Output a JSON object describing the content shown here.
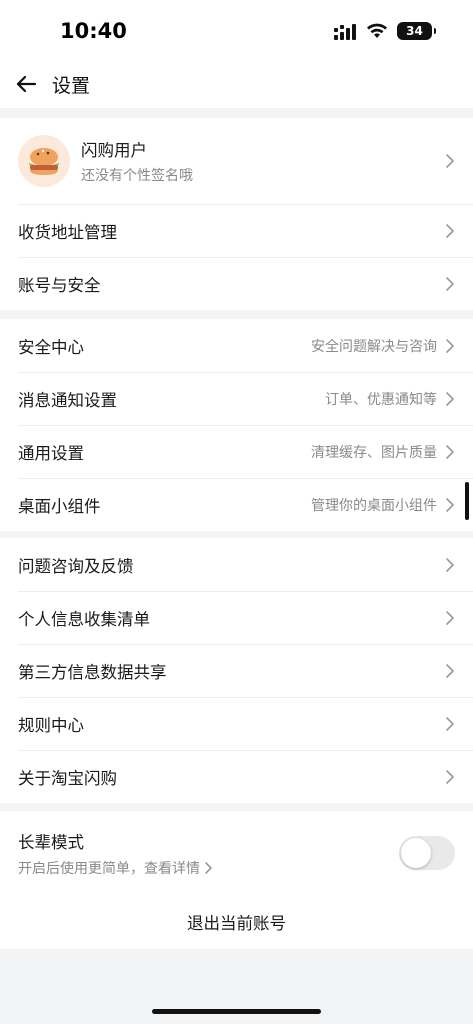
{
  "status_bar": {
    "time": "10:40",
    "battery": "34"
  },
  "nav": {
    "title": "设置"
  },
  "profile": {
    "name": "闪购用户",
    "signature": "还没有个性签名哦"
  },
  "account_section": [
    {
      "label": "收货地址管理"
    },
    {
      "label": "账号与安全"
    }
  ],
  "settings_section": [
    {
      "label": "安全中心",
      "value": "安全问题解决与咨询"
    },
    {
      "label": "消息通知设置",
      "value": "订单、优惠通知等"
    },
    {
      "label": "通用设置",
      "value": "清理缓存、图片质量"
    },
    {
      "label": "桌面小组件",
      "value": "管理你的桌面小组件"
    }
  ],
  "info_section": [
    {
      "label": "问题咨询及反馈"
    },
    {
      "label": "个人信息收集清单"
    },
    {
      "label": "第三方信息数据共享"
    },
    {
      "label": "规则中心"
    },
    {
      "label": "关于淘宝闪购"
    }
  ],
  "elder_mode": {
    "title": "长辈模式",
    "subtitle": "开启后使用更简单，查看详情",
    "enabled": false
  },
  "logout": {
    "label": "退出当前账号"
  },
  "icons": {
    "back": "arrow-left-icon",
    "chevron": "chevron-right-icon",
    "avatar": "burger-avatar-icon",
    "signal": "cellular-signal-icon",
    "wifi": "wifi-icon",
    "battery": "battery-icon"
  }
}
